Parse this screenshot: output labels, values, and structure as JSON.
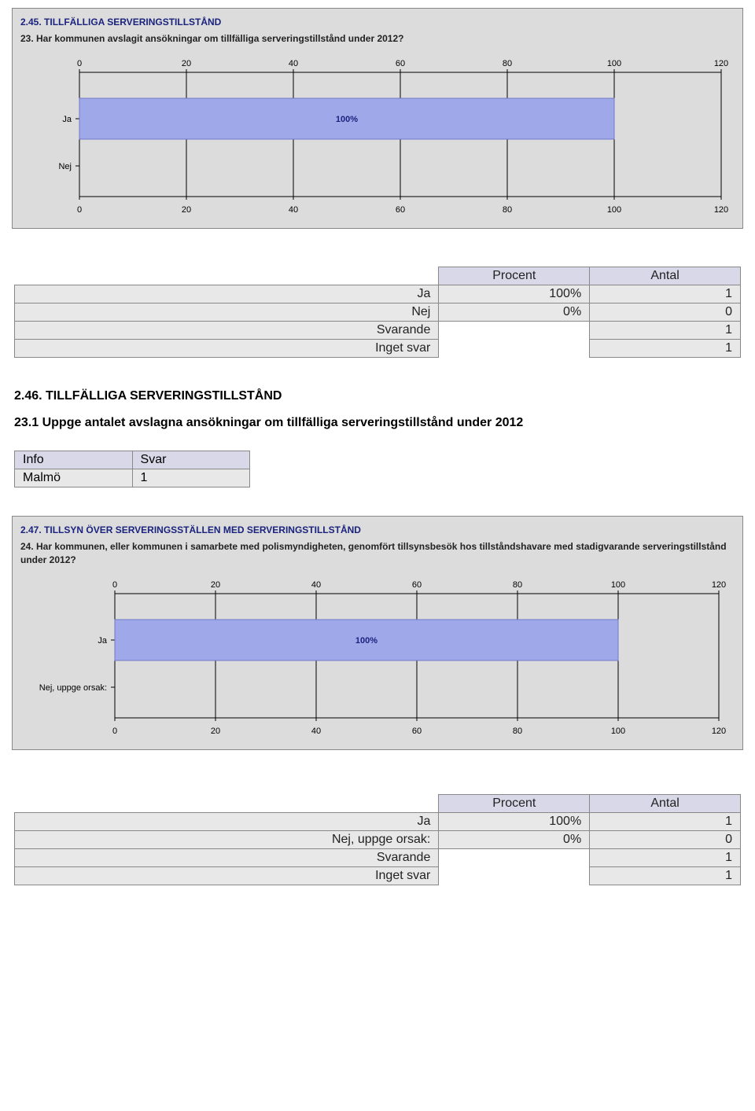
{
  "chart1": {
    "title": "2.45. TILLFÄLLIGA SERVERINGSTILLSTÅND",
    "question": "23. Har kommunen avslagit ansökningar om tillfälliga serveringstillstånd under 2012?",
    "ticks": [
      "0",
      "20",
      "40",
      "60",
      "80",
      "100",
      "120"
    ],
    "categories": [
      "Ja",
      "Nej"
    ],
    "bar_label": "100%"
  },
  "table1": {
    "headers": [
      "Procent",
      "Antal"
    ],
    "rows": [
      {
        "label": "Ja",
        "procent": "100%",
        "antal": "1"
      },
      {
        "label": "Nej",
        "procent": "0%",
        "antal": "0"
      },
      {
        "label": "Svarande",
        "procent": "",
        "antal": "1"
      },
      {
        "label": "Inget svar",
        "procent": "",
        "antal": "1"
      }
    ]
  },
  "section246": {
    "heading": "2.46. TILLFÄLLIGA SERVERINGSTILLSTÅND",
    "question": "23.1 Uppge antalet avslagna ansökningar om tillfälliga serveringstillstånd under 2012",
    "info_headers": [
      "Info",
      "Svar"
    ],
    "info_rows": [
      {
        "info": "Malmö",
        "svar": "1"
      }
    ]
  },
  "chart2": {
    "title": "2.47. TILLSYN ÖVER SERVERINGSSTÄLLEN MED SERVERINGSTILLSTÅND",
    "question": "24. Har kommunen, eller kommunen i samarbete med polismyndigheten, genomfört tillsynsbesök hos tillståndshavare med stadigvarande serveringstillstånd under 2012?",
    "ticks": [
      "0",
      "20",
      "40",
      "60",
      "80",
      "100",
      "120"
    ],
    "categories": [
      "Ja",
      "Nej, uppge orsak:"
    ],
    "bar_label": "100%"
  },
  "table2": {
    "headers": [
      "Procent",
      "Antal"
    ],
    "rows": [
      {
        "label": "Ja",
        "procent": "100%",
        "antal": "1"
      },
      {
        "label": "Nej, uppge orsak:",
        "procent": "0%",
        "antal": "0"
      },
      {
        "label": "Svarande",
        "procent": "",
        "antal": "1"
      },
      {
        "label": "Inget svar",
        "procent": "",
        "antal": "1"
      }
    ]
  },
  "chart_data": [
    {
      "type": "bar",
      "orientation": "horizontal",
      "title": "2.45. TILLFÄLLIGA SERVERINGSTILLSTÅND — 23. Har kommunen avslagit ansökningar om tillfälliga serveringstillstånd under 2012?",
      "categories": [
        "Ja",
        "Nej"
      ],
      "values": [
        100,
        0
      ],
      "xlabel": "",
      "ylabel": "",
      "xlim": [
        0,
        120
      ],
      "xticks": [
        0,
        20,
        40,
        60,
        80,
        100,
        120
      ]
    },
    {
      "type": "bar",
      "orientation": "horizontal",
      "title": "2.47. TILLSYN ÖVER SERVERINGSSTÄLLEN MED SERVERINGSTILLSTÅND — 24. Har kommunen, eller kommunen i samarbete med polismyndigheten, genomfört tillsynsbesök hos tillståndshavare med stadigvarande serveringstillstånd under 2012?",
      "categories": [
        "Ja",
        "Nej, uppge orsak:"
      ],
      "values": [
        100,
        0
      ],
      "xlabel": "",
      "ylabel": "",
      "xlim": [
        0,
        120
      ],
      "xticks": [
        0,
        20,
        40,
        60,
        80,
        100,
        120
      ]
    }
  ]
}
